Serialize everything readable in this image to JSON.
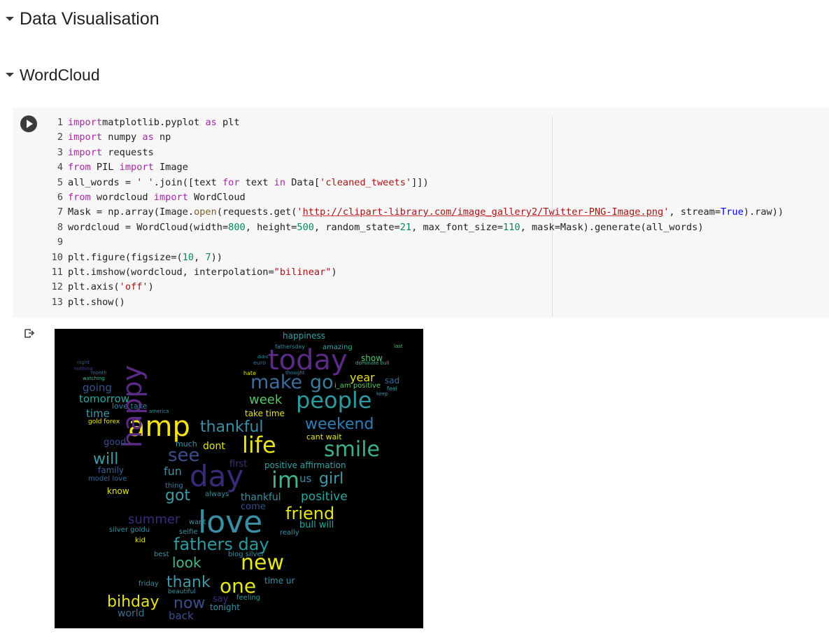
{
  "sections": [
    {
      "title": "Data Visualisation"
    },
    {
      "title": "WordCloud"
    }
  ],
  "code_lines": [
    [
      [
        "kw",
        "import"
      ],
      [
        "",
        "matplotlib.pyplot "
      ],
      [
        "kw",
        "as"
      ],
      [
        "",
        " plt"
      ]
    ],
    [
      [
        "kw",
        "import"
      ],
      [
        "",
        " numpy "
      ],
      [
        "kw",
        "as"
      ],
      [
        "",
        " np"
      ]
    ],
    [
      [
        "kw",
        "import"
      ],
      [
        "",
        " requests"
      ]
    ],
    [
      [
        "kw",
        "from"
      ],
      [
        "",
        " PIL "
      ],
      [
        "kw",
        "import"
      ],
      [
        "",
        " Image"
      ]
    ],
    [
      [
        "",
        "all_words = "
      ],
      [
        "st",
        "' '"
      ],
      [
        "",
        ".join([text "
      ],
      [
        "kw",
        "for"
      ],
      [
        "",
        " text "
      ],
      [
        "kw",
        "in"
      ],
      [
        "",
        " Data["
      ],
      [
        "st",
        "'cleaned_tweets'"
      ],
      [
        "",
        "]])"
      ]
    ],
    [
      [
        "kw",
        "from"
      ],
      [
        "",
        " wordcloud "
      ],
      [
        "kw",
        "import"
      ],
      [
        "",
        " WordCloud"
      ]
    ],
    [
      [
        "",
        "Mask = np.array(Image."
      ],
      [
        "bi",
        "open"
      ],
      [
        "",
        "(requests.get("
      ],
      [
        "st",
        "'"
      ],
      [
        "url",
        "http://clipart-library.com/image_gallery2/Twitter-PNG-Image.png"
      ],
      [
        "st",
        "'"
      ],
      [
        "",
        ", stream="
      ],
      [
        "ka",
        "True"
      ],
      [
        "",
        ").raw))"
      ]
    ],
    [
      [
        "",
        "wordcloud = WordCloud(width="
      ],
      [
        "nm",
        "800"
      ],
      [
        "",
        ", height="
      ],
      [
        "nm",
        "500"
      ],
      [
        "",
        ", random_state="
      ],
      [
        "nm",
        "21"
      ],
      [
        "",
        ", max_font_size="
      ],
      [
        "nm",
        "110"
      ],
      [
        "",
        ", mask=Mask).generate(all_words)"
      ]
    ],
    [],
    [
      [
        "",
        "plt.figure(figsize=("
      ],
      [
        "nm",
        "10"
      ],
      [
        "",
        ", "
      ],
      [
        "nm",
        "7"
      ],
      [
        "",
        "))"
      ]
    ],
    [
      [
        "",
        "plt.imshow(wordcloud, interpolation="
      ],
      [
        "st",
        "\"bilinear\""
      ],
      [
        "",
        ")"
      ]
    ],
    [
      [
        "",
        "plt.axis("
      ],
      [
        "st",
        "'off'"
      ],
      [
        "",
        ")"
      ]
    ],
    [
      [
        "",
        "plt.show()"
      ]
    ]
  ],
  "wordcloud_words": [
    [
      "happiness",
      12,
      "#3aa0a0",
      326,
      4,
      0
    ],
    [
      "fathersday",
      8,
      "#2f8f9f",
      315,
      22,
      0
    ],
    [
      "amazing",
      10,
      "#2aa7a0",
      383,
      22,
      0
    ],
    [
      "last",
      7,
      "#49c16f",
      485,
      22,
      0
    ],
    [
      "today",
      40,
      "#5b2a86",
      305,
      25,
      0
    ],
    [
      "show",
      12,
      "#55c66a",
      438,
      36,
      0
    ],
    [
      "didnt",
      6,
      "#3b8fa5",
      290,
      38,
      0
    ],
    [
      "euro",
      8,
      "#3c6f9a",
      284,
      45,
      0
    ],
    [
      "dominate bull",
      7,
      "#46b08a",
      430,
      46,
      0
    ],
    [
      "night",
      7,
      "#3a4f8a",
      32,
      45,
      0
    ],
    [
      "month",
      7,
      "#3a6f94",
      52,
      60,
      0
    ],
    [
      "nothing",
      7,
      "#3a3f8a",
      28,
      54,
      0
    ],
    [
      "watching",
      7,
      "#41b58b",
      40,
      68,
      0
    ],
    [
      "make",
      27,
      "#3e6c9b",
      280,
      63,
      0
    ],
    [
      "go",
      27,
      "#3c7e9a",
      365,
      63,
      0
    ],
    [
      "year",
      16,
      "#e5e21e",
      422,
      62,
      0
    ],
    [
      "sad",
      12,
      "#2e6e9a",
      472,
      68,
      0
    ],
    [
      "hate",
      8,
      "#e5e21e",
      270,
      60,
      0
    ],
    [
      "i_am positive",
      10,
      "#5dc963",
      400,
      77,
      0
    ],
    [
      "thought",
      7,
      "#3a7fa0",
      330,
      60,
      0
    ],
    [
      "feel",
      8,
      "#2f9f9f",
      475,
      82,
      0
    ],
    [
      "keep",
      7,
      "#3b8fa5",
      460,
      90,
      0
    ],
    [
      "going",
      15,
      "#3a548c",
      40,
      77,
      0
    ],
    [
      "tomorrow",
      15,
      "#2ca7a0",
      35,
      93,
      0
    ],
    [
      "people",
      32,
      "#2d9aa0",
      345,
      86,
      0
    ],
    [
      "week",
      18,
      "#56c667",
      278,
      93,
      0
    ],
    [
      "love take",
      11,
      "#2f7f9f",
      82,
      105,
      0
    ],
    [
      "time",
      15,
      "#3a9aa5",
      45,
      114,
      0
    ],
    [
      "take time",
      12,
      "#e1e41e",
      272,
      115,
      0
    ],
    [
      "america",
      7,
      "#3b8fa5",
      135,
      115,
      0
    ],
    [
      "amp",
      40,
      "#f4e31c",
      105,
      120,
      0
    ],
    [
      "thankful",
      22,
      "#3b8fa5",
      208,
      130,
      0
    ],
    [
      "weekend",
      22,
      "#2d7fb8",
      358,
      126,
      0
    ],
    [
      "gold forex",
      9,
      "#e8e71c",
      48,
      129,
      0
    ],
    [
      "happy",
      38,
      "#5b2a86",
      92,
      170,
      270
    ],
    [
      "life",
      32,
      "#e7e41c",
      268,
      150,
      0
    ],
    [
      "smile",
      30,
      "#3fae8a",
      385,
      158,
      0
    ],
    [
      "cant wait",
      11,
      "#e8e420",
      360,
      149,
      0
    ],
    [
      "good",
      13,
      "#3a4f8a",
      70,
      156,
      0
    ],
    [
      "dont",
      14,
      "#e4e41e",
      212,
      161,
      0
    ],
    [
      "much",
      11,
      "#3b8fa5",
      173,
      159,
      0
    ],
    [
      "see",
      26,
      "#3e4c8c",
      162,
      168,
      0
    ],
    [
      "will",
      22,
      "#3a9aa5",
      55,
      176,
      0
    ],
    [
      "first",
      13,
      "#452c7a",
      250,
      187,
      0
    ],
    [
      "positive affirmation",
      12,
      "#3aa0a0",
      300,
      189,
      0
    ],
    [
      "family",
      12,
      "#3b5f95",
      62,
      196,
      0
    ],
    [
      "fun",
      16,
      "#3b8fa5",
      156,
      196,
      0
    ],
    [
      "day",
      42,
      "#3a2a78",
      193,
      190,
      0
    ],
    [
      "im",
      32,
      "#42b38a",
      310,
      200,
      0
    ],
    [
      "us",
      15,
      "#3b8fa5",
      350,
      207,
      0
    ],
    [
      "girl",
      22,
      "#3f9aa5",
      378,
      204,
      0
    ],
    [
      "model love",
      10,
      "#2f6f9a",
      48,
      210,
      0
    ],
    [
      "thing",
      10,
      "#3b7fa0",
      158,
      220,
      0
    ],
    [
      "know",
      12,
      "#e1e41e",
      75,
      226,
      0
    ],
    [
      "got",
      22,
      "#3f9aa5",
      158,
      228,
      0
    ],
    [
      "positive",
      17,
      "#2ca7a0",
      352,
      232,
      0
    ],
    [
      "thankful",
      14,
      "#3b8fa5",
      266,
      234,
      0
    ],
    [
      "always",
      10,
      "#3b8fa5",
      215,
      232,
      0
    ],
    [
      "friend",
      24,
      "#e5e21e",
      330,
      252,
      0
    ],
    [
      "come",
      13,
      "#3a4f8a",
      266,
      248,
      0
    ],
    [
      "summer",
      18,
      "#3a2a78",
      105,
      264,
      0
    ],
    [
      "love",
      44,
      "#3b8fa5",
      205,
      255,
      0
    ],
    [
      "bull will",
      13,
      "#2ca7a0",
      350,
      274,
      0
    ],
    [
      "want",
      10,
      "#3b8fa5",
      192,
      272,
      0
    ],
    [
      "selfie",
      10,
      "#3b8fa5",
      178,
      286,
      0
    ],
    [
      "silver goldu",
      10,
      "#3b8fa5",
      78,
      283,
      0
    ],
    [
      "really",
      10,
      "#3b8fa5",
      322,
      287,
      0
    ],
    [
      "fathers day",
      24,
      "#2d9aa0",
      170,
      296,
      0
    ],
    [
      "kid",
      10,
      "#e5e21e",
      115,
      298,
      0
    ],
    [
      "best",
      10,
      "#3b8fa5",
      142,
      318,
      0
    ],
    [
      "look",
      20,
      "#47b58a",
      168,
      324,
      0
    ],
    [
      "new",
      30,
      "#e8e71c",
      266,
      320,
      0
    ],
    [
      "blog silver",
      10,
      "#3b8fa5",
      248,
      318,
      0
    ],
    [
      "thank",
      22,
      "#3f9aa5",
      160,
      352,
      0
    ],
    [
      "one",
      28,
      "#e8e71c",
      236,
      354,
      0
    ],
    [
      "time ur",
      12,
      "#3b8fa5",
      300,
      354,
      0
    ],
    [
      "friday",
      10,
      "#3b8fa5",
      120,
      360,
      0
    ],
    [
      "bihday",
      22,
      "#e5e21e",
      75,
      380,
      0
    ],
    [
      "now",
      22,
      "#3a4f8a",
      170,
      382,
      0
    ],
    [
      "say",
      13,
      "#3a2a78",
      226,
      380,
      0
    ],
    [
      "feeling",
      10,
      "#3b8fa5",
      260,
      380,
      0
    ],
    [
      "tonight",
      12,
      "#3b8fa5",
      222,
      392,
      0
    ],
    [
      "world",
      14,
      "#3a6f94",
      90,
      400,
      0
    ],
    [
      "back",
      15,
      "#3a4f8a",
      163,
      403,
      0
    ],
    [
      "beautiful",
      9,
      "#3b8fa5",
      162,
      372,
      0
    ]
  ]
}
